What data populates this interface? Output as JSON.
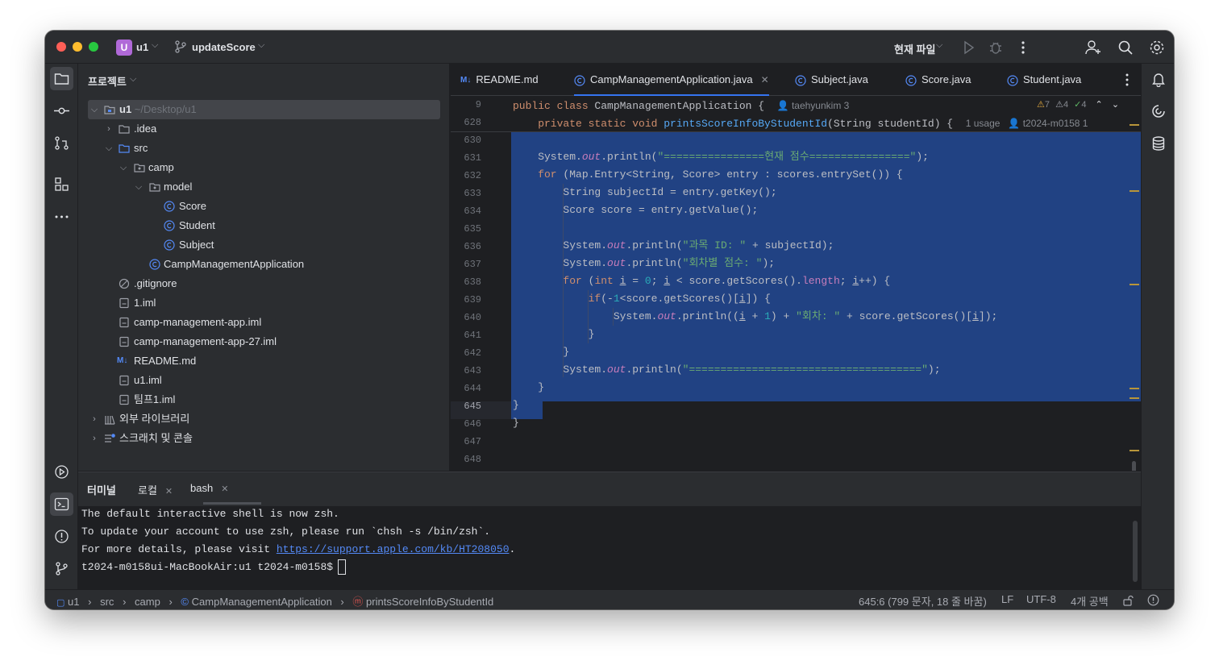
{
  "titlebar": {
    "project_badge": "U",
    "project_name": "u1",
    "branch": "updateScore",
    "current_file": "현재 파일"
  },
  "project_panel": {
    "header": "프로젝트",
    "root_name": "u1",
    "root_path": "~/Desktop/u1",
    "items": {
      "idea": ".idea",
      "src": "src",
      "camp": "camp",
      "model": "model",
      "score": "Score",
      "student": "Student",
      "subject": "Subject",
      "camp_app": "CampManagementApplication",
      "gitignore": ".gitignore",
      "iml1": "1.iml",
      "iml_camp": "camp-management-app.iml",
      "iml_camp27": "camp-management-app-27.iml",
      "readme": "README.md",
      "u1iml": "u1.iml",
      "teamiml": "팀프1.iml",
      "ext_libs": "외부 라이브러리",
      "scratches": "스크래치 및 콘솔"
    }
  },
  "tabs": [
    {
      "label": "README.md",
      "icon": "markdown-icon"
    },
    {
      "label": "CampManagementApplication.java",
      "icon": "java-class-icon",
      "active": true
    },
    {
      "label": "Subject.java",
      "icon": "java-class-icon"
    },
    {
      "label": "Score.java",
      "icon": "java-class-icon"
    },
    {
      "label": "Student.java",
      "icon": "java-class-icon"
    }
  ],
  "editor": {
    "sticky": [
      {
        "line": "9",
        "author": "taehyunkim 3"
      },
      {
        "line": "628",
        "usage": "1 usage",
        "author": "t2024-m0158 1"
      }
    ],
    "inspections": {
      "warnings": "7",
      "weak": "4",
      "ok": "4"
    },
    "line_numbers": [
      "630",
      "631",
      "632",
      "633",
      "634",
      "635",
      "636",
      "637",
      "638",
      "639",
      "640",
      "641",
      "642",
      "643",
      "644",
      "645",
      "646",
      "647",
      "648"
    ],
    "current_line": "645",
    "code": {
      "l631_str": "\"================현재 점수================\"",
      "l636_str": "\"과목 ID: \"",
      "l637_str": "\"회차별 점수: \"",
      "l640_str": "\"회차: \"",
      "l643_str": "\"=====================================\""
    }
  },
  "terminal": {
    "title": "터미널",
    "tabs": [
      "로컬",
      "bash"
    ],
    "lines": [
      "The default interactive shell is now zsh.",
      "To update your account to use zsh, please run `chsh -s /bin/zsh`.",
      "For more details, please visit "
    ],
    "link": "https://support.apple.com/kb/HT208050",
    "link_suffix": ".",
    "prompt": "t2024-m0158ui-MacBookAir:u1 t2024-m0158$"
  },
  "statusbar": {
    "breadcrumb": [
      "u1",
      "src",
      "camp",
      "CampManagementApplication",
      "printsScoreInfoByStudentId"
    ],
    "position": "645:6 (799 문자, 18 줄 바꿈)",
    "line_sep": "LF",
    "encoding": "UTF-8",
    "indent": "4개 공백"
  },
  "colors": {
    "accent": "#3574f0",
    "selection": "#214283",
    "keyword": "#cf8e6d",
    "string": "#6aab73",
    "number": "#2aacb8",
    "field": "#c77dbb",
    "method": "#56a8f5"
  }
}
